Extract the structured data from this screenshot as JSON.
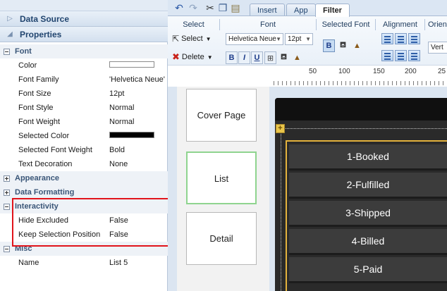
{
  "left_panel": {
    "data_source_label": "Data Source",
    "properties_label": "Properties",
    "sections": {
      "font": "Font",
      "appearance": "Appearance",
      "data_formatting": "Data Formatting",
      "interactivity": "Interactivity",
      "misc": "Misc"
    },
    "font_props": [
      {
        "label": "Color",
        "value": ""
      },
      {
        "label": "Font Family",
        "value": "'Helvetica Neue'"
      },
      {
        "label": "Font Size",
        "value": "12pt"
      },
      {
        "label": "Font Style",
        "value": "Normal"
      },
      {
        "label": "Font Weight",
        "value": "Normal"
      },
      {
        "label": "Selected Color",
        "value": ""
      },
      {
        "label": "Selected Font Weight",
        "value": "Bold"
      },
      {
        "label": "Text Decoration",
        "value": "None"
      }
    ],
    "interactivity_props": [
      {
        "label": "Hide Excluded",
        "value": "False"
      },
      {
        "label": "Keep Selection Position",
        "value": "False"
      }
    ],
    "misc_props": [
      {
        "label": "Name",
        "value": "List 5"
      }
    ],
    "colors": {
      "color_swatch": "#ffffff",
      "selected_color_swatch": "#000000",
      "highlight_box": "#e1141b"
    }
  },
  "ribbon": {
    "tabs": [
      "Insert",
      "App",
      "Filter"
    ],
    "active_tab": "Filter",
    "groups": {
      "select": "Select",
      "font": "Font",
      "selected_font": "Selected Font",
      "alignment": "Alignment",
      "orientation": "Orien"
    },
    "select_button": "Select",
    "delete_button": "Delete",
    "font_family_value": "Helvetica Neue",
    "font_size_value": "12pt",
    "orientation_value": "Vert",
    "format_buttons": [
      "B",
      "I",
      "U"
    ],
    "selected_font_bold": "B"
  },
  "ruler": {
    "marks": [
      "50",
      "100",
      "150",
      "200",
      "25"
    ]
  },
  "slides": [
    {
      "label": "Cover Page"
    },
    {
      "label": "List"
    },
    {
      "label": "Detail"
    }
  ],
  "list_items": [
    "1-Booked",
    "2-Fulfilled",
    "3-Shipped",
    "4-Billed",
    "5-Paid"
  ]
}
